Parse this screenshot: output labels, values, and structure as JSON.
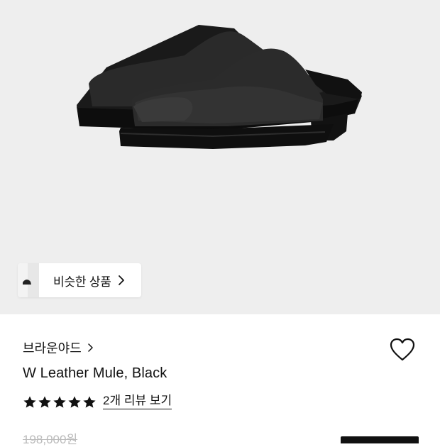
{
  "hero": {
    "similar_products_label": "비슷한 상품"
  },
  "product": {
    "brand": "브라운야드",
    "title": "W Leather Mule, Black",
    "rating": 5,
    "rating_max": 5,
    "review_link": "2개 리뷰 보기",
    "original_price": "198,000원"
  },
  "icons": {
    "similar_chevron": "chevron-right-icon",
    "brand_chevron": "chevron-right-icon",
    "wishlist": "heart-outline-icon",
    "star": "star-filled-icon"
  },
  "colors": {
    "hero_background": "#eeeeee",
    "text": "#111111",
    "strikethrough_price": "#bbbbbb"
  }
}
